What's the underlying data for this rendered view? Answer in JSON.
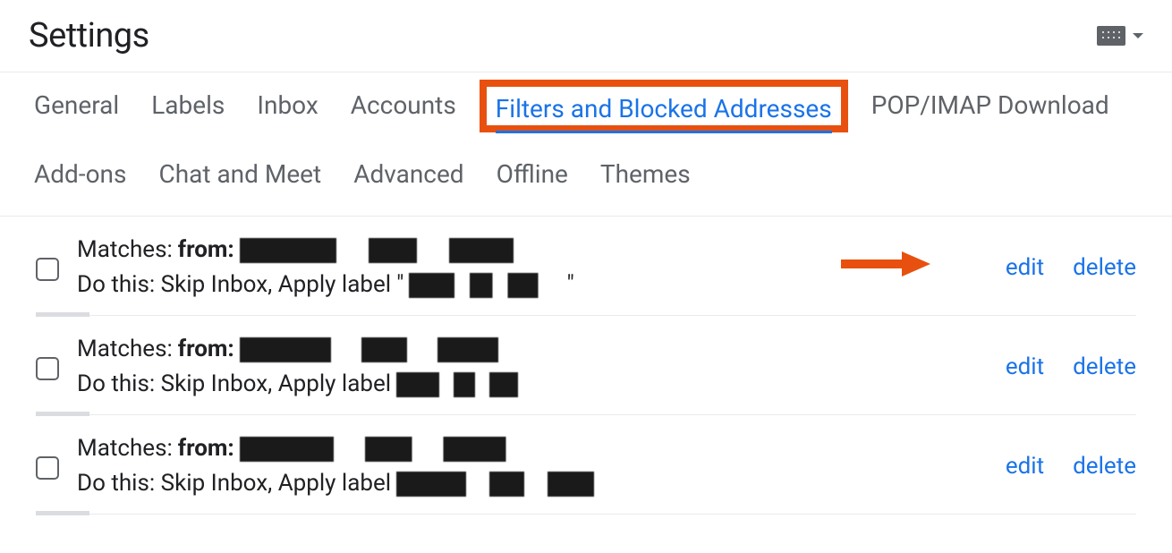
{
  "header": {
    "title": "Settings"
  },
  "tabs": [
    {
      "label": "General",
      "active": false
    },
    {
      "label": "Labels",
      "active": false
    },
    {
      "label": "Inbox",
      "active": false
    },
    {
      "label": "Accounts",
      "active": false
    },
    {
      "label": "Filters and Blocked Addresses",
      "active": true
    },
    {
      "label": "POP/IMAP Download",
      "active": false
    },
    {
      "label": "Add-ons",
      "active": false
    },
    {
      "label": "Chat and Meet",
      "active": false
    },
    {
      "label": "Advanced",
      "active": false
    },
    {
      "label": "Offline",
      "active": false
    },
    {
      "label": "Themes",
      "active": false
    }
  ],
  "filter_labels": {
    "matches_prefix": "Matches: ",
    "from_label": "from:",
    "do_this_prefix": "Do this: Skip Inbox, Apply label "
  },
  "filters": [
    {
      "from_redacted": true,
      "label_redacted": true,
      "edit_label": "edit",
      "delete_label": "delete",
      "highlight_arrow": true
    },
    {
      "from_redacted": true,
      "label_redacted": true,
      "edit_label": "edit",
      "delete_label": "delete",
      "highlight_arrow": false
    },
    {
      "from_redacted": true,
      "label_redacted": true,
      "edit_label": "edit",
      "delete_label": "delete",
      "highlight_arrow": false
    }
  ],
  "annotations": {
    "active_tab_boxed": true,
    "arrow_color": "#e8500f"
  }
}
